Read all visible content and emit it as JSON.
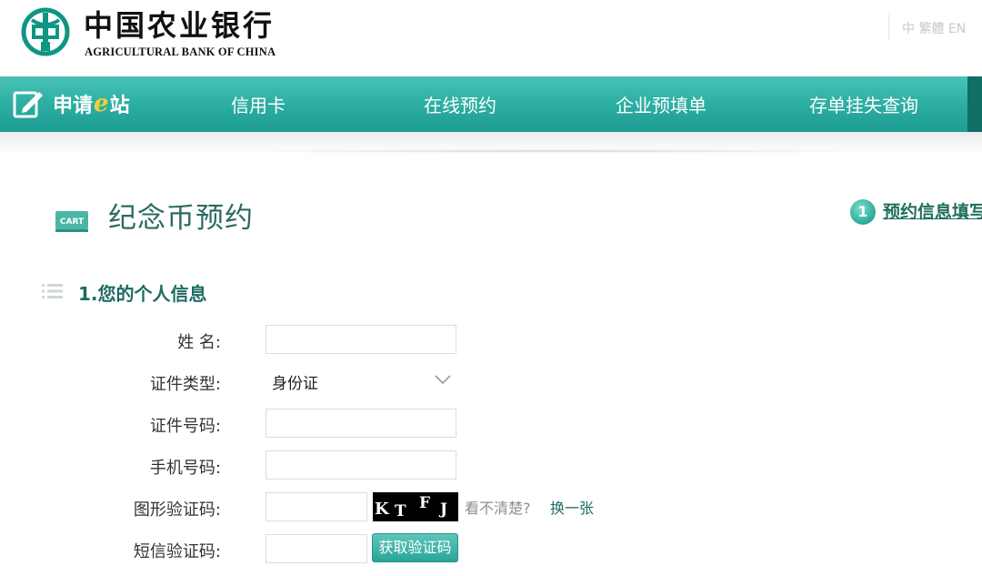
{
  "header": {
    "bank_name_cn": "中国农业银行",
    "bank_name_en": "AGRICULTURAL BANK OF CHINA",
    "top_link": "中 繁體 EN"
  },
  "nav": {
    "brand_prefix": "申请",
    "brand_e": "e",
    "brand_suffix": "站",
    "items": [
      {
        "label": "信用卡"
      },
      {
        "label": "在线预约"
      },
      {
        "label": "企业预填单"
      },
      {
        "label": "存单挂失查询"
      }
    ]
  },
  "page": {
    "title": "纪念币预约",
    "cart_icon_text": "CART"
  },
  "steps": [
    {
      "number": "1",
      "label": "预约信息填写"
    }
  ],
  "section": {
    "title": "1.您的个人信息"
  },
  "form": {
    "name_label": "姓  名:",
    "id_type_label": "证件类型:",
    "id_type_value": "身份证",
    "id_number_label": "证件号码:",
    "phone_label": "手机号码:",
    "captcha_label": "图形验证码:",
    "sms_code_label": "短信验证码:",
    "captcha_chars": [
      "K",
      "T",
      "F",
      "J"
    ],
    "hint_text": "看不清楚?",
    "refresh_link": "换一张",
    "sms_button": "获取验证码"
  },
  "colors": {
    "nav_teal": "#2fb0a4",
    "title_green": "#2d6a63",
    "accent_yellow": "#f1cf3e",
    "button_teal": "#2aa598"
  }
}
